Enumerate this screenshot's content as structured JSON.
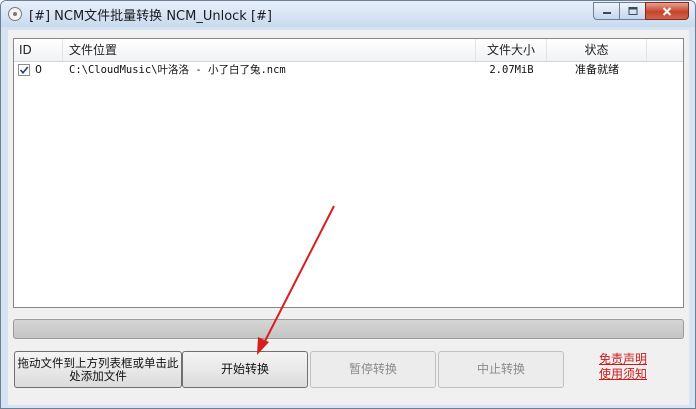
{
  "window": {
    "title": "[#] NCM文件批量转换 NCM_Unlock [#]"
  },
  "table": {
    "columns": {
      "id": "ID",
      "path": "文件位置",
      "size": "文件大小",
      "status": "状态"
    },
    "rows": [
      {
        "checked": true,
        "id": "0",
        "path": "C:\\CloudMusic\\叶洛洛 - 小了白了兔.ncm",
        "size": "2.07MiB",
        "status": "准备就绪"
      }
    ]
  },
  "progress": {
    "value_percent": 0
  },
  "buttons": {
    "add_files": "拖动文件到上方列表框或单击此处添加文件",
    "start": "开始转换",
    "pause": "暂停转换",
    "stop": "中止转换"
  },
  "notice": {
    "line1": "免责声明",
    "line2": "使用须知"
  },
  "colors": {
    "notice_red": "#d01a1a",
    "arrow_red": "#d62020"
  }
}
